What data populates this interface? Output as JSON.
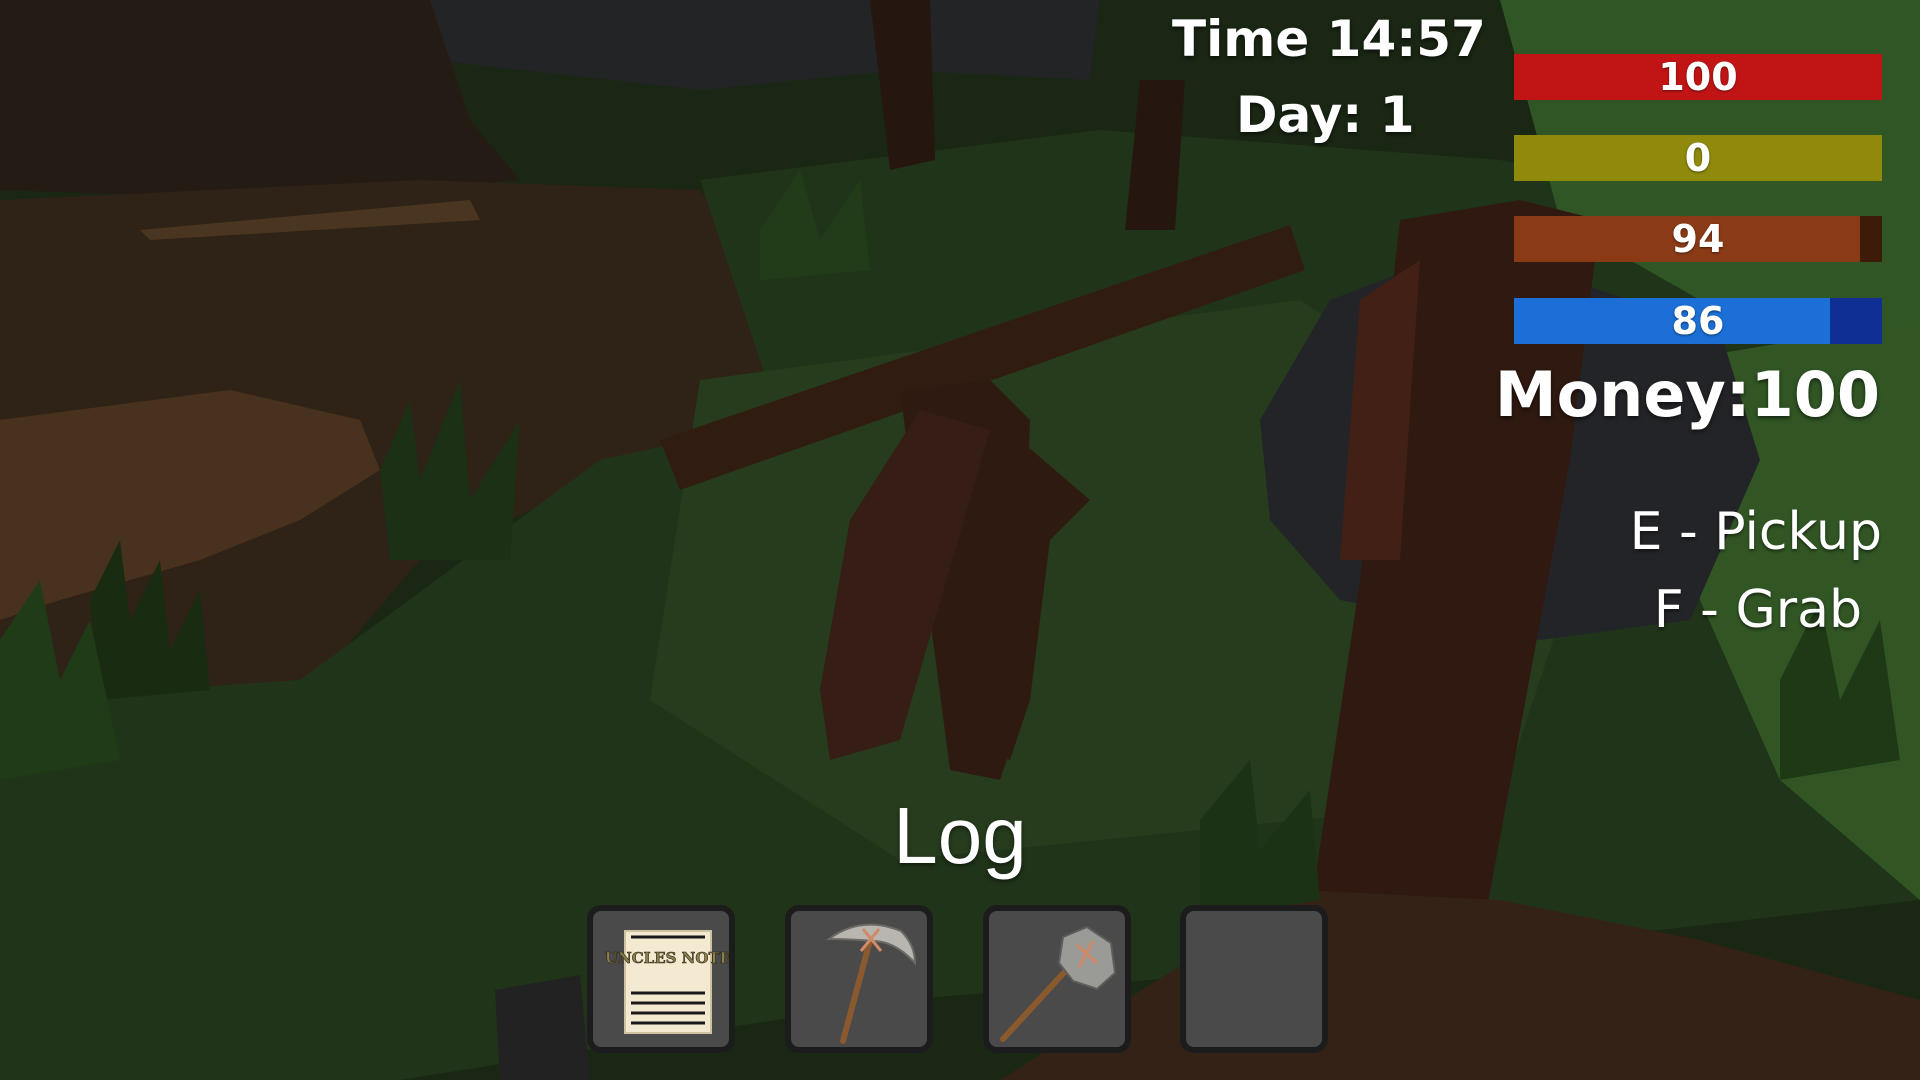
{
  "hud": {
    "time": "Time 14:57",
    "day": "Day: 1",
    "money": "Money:100"
  },
  "stats": {
    "health": {
      "value": "100",
      "fraction": 1.0,
      "color": "#c11515",
      "track": "#5a0a0a"
    },
    "stamina": {
      "value": "0",
      "fraction": 1.0,
      "color": "#8f8a0b",
      "track": "#4a4705"
    },
    "hunger": {
      "value": "94",
      "fraction": 0.94,
      "color": "#8a3a15",
      "track": "#3e1a08"
    },
    "thirst": {
      "value": "86",
      "fraction": 0.86,
      "color": "#1b6fd6",
      "track": "#0f2f95"
    }
  },
  "prompts": {
    "pickup": "E - Pickup",
    "grab": "F - Grab"
  },
  "selected_item": "Log",
  "hotbar": {
    "slots": [
      {
        "icon": "uncles-note-icon",
        "label": "UNCLES NOTE"
      },
      {
        "icon": "pickaxe-icon"
      },
      {
        "icon": "stone-axe-icon"
      },
      {
        "icon": "empty"
      }
    ]
  }
}
